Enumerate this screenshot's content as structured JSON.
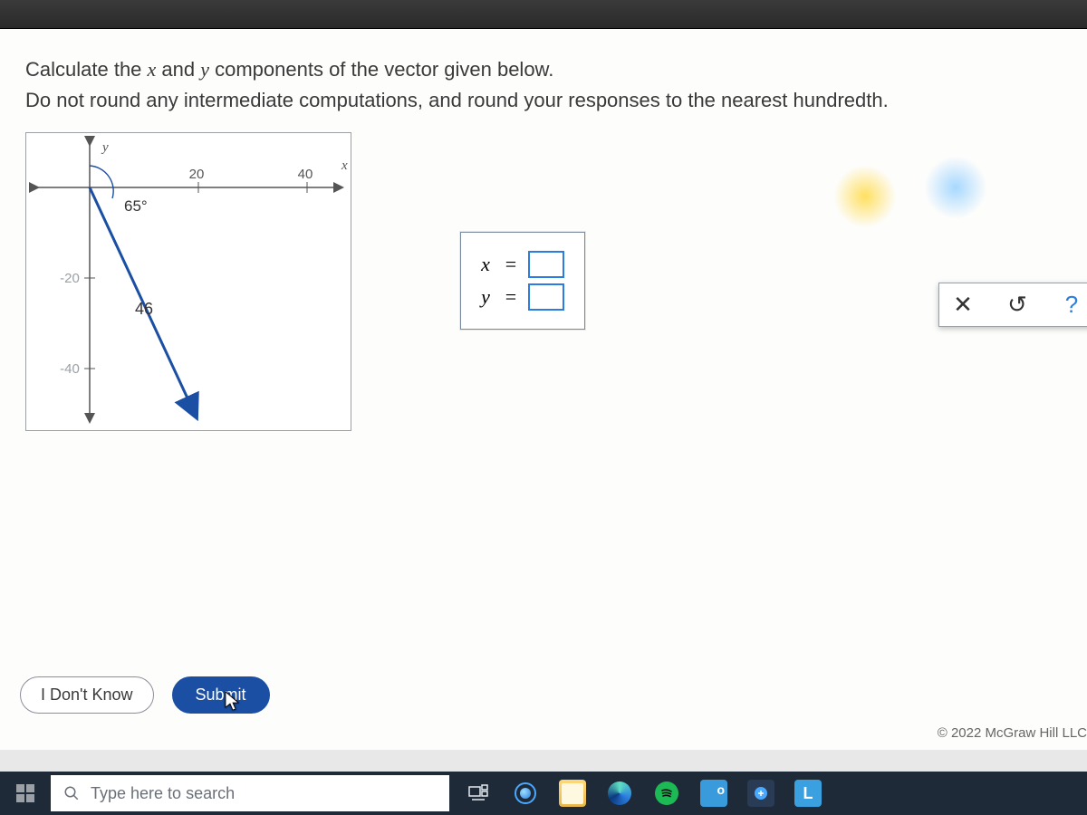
{
  "prompt": {
    "line1_pre": "Calculate the ",
    "line1_x": "x",
    "line1_mid": " and ",
    "line1_y": "y",
    "line1_post": " components of the vector given below.",
    "line2": "Do not round any intermediate computations, and round your responses to the nearest hundredth."
  },
  "graph": {
    "x_axis_label": "x",
    "y_axis_label": "y",
    "x_ticks": [
      "20",
      "40"
    ],
    "y_ticks": [
      "-20",
      "-40"
    ],
    "vector_angle_label": "65°",
    "vector_magnitude_label": "46"
  },
  "answers": {
    "rows": [
      {
        "var": "x",
        "eq": "=",
        "value": ""
      },
      {
        "var": "y",
        "eq": "=",
        "value": ""
      }
    ]
  },
  "tools": {
    "clear": "✕",
    "reset": "↺",
    "help": "?"
  },
  "buttons": {
    "idk": "I Don't Know",
    "submit": "Submit"
  },
  "footer": {
    "copyright": "© 2022 McGraw Hill LLC"
  },
  "taskbar": {
    "search_placeholder": "Type here to search",
    "l_tile": "L"
  }
}
